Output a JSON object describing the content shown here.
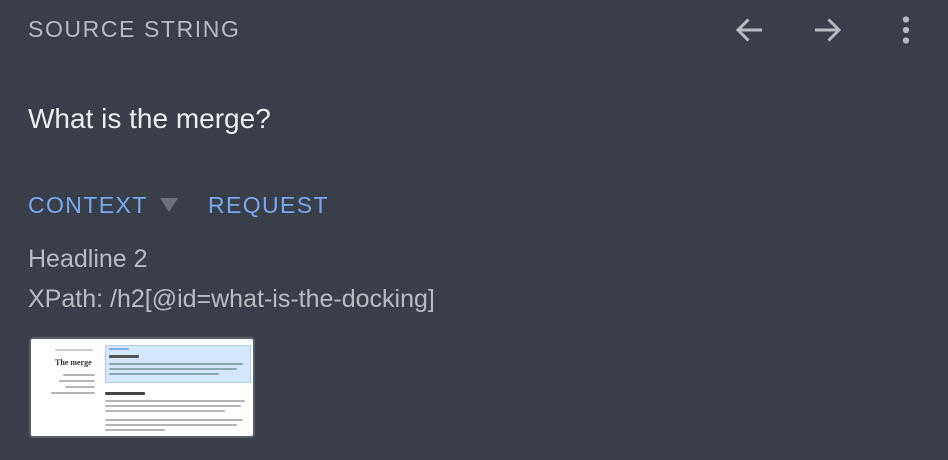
{
  "header": {
    "title": "SOURCE STRING"
  },
  "source": {
    "text": "What is the merge?"
  },
  "tabs": [
    {
      "label": "CONTEXT",
      "active": true
    },
    {
      "label": "REQUEST",
      "active": false
    }
  ],
  "context": {
    "headline": "Headline 2",
    "xpath": "XPath: /h2[@id=what-is-the-docking]"
  },
  "screenshot": {
    "page_title": "The merge"
  },
  "icons": {
    "back": "arrow-left-icon",
    "forward": "arrow-right-icon",
    "menu": "more-vertical-icon",
    "dropdown": "caret-down-icon"
  },
  "colors": {
    "background": "#393e48",
    "accent": "#78a8f1",
    "text_primary": "#ecedf0",
    "text_secondary": "#b6bac1"
  }
}
